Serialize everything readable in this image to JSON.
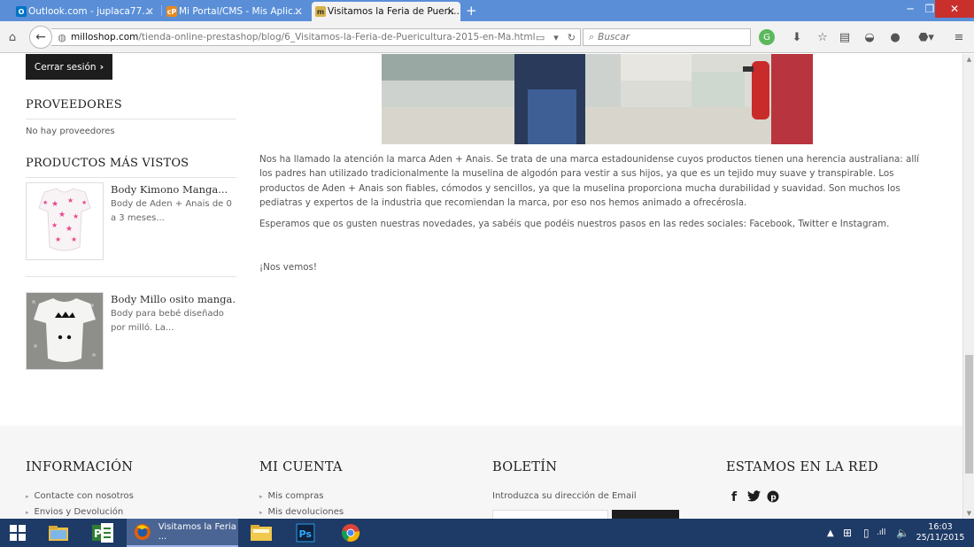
{
  "browser": {
    "tabs": [
      {
        "label": "Outlook.com - juplaca77...",
        "favicon": "outlook-icon",
        "color": "#0072c6",
        "active": false
      },
      {
        "label": "Mi Portal/CMS - Mis Aplic...",
        "favicon": "portal-icon",
        "color": "#e8891c",
        "active": false
      },
      {
        "label": "Visitamos la Feria de Pueri...",
        "favicon": "millo-icon",
        "color": "#d4b14a",
        "active": true
      }
    ],
    "url_host": "milloshop.com",
    "url_path": "/tienda-online-prestashop/blog/6_Visitamos-la-Feria-de-Puericultura-2015-en-Ma.html",
    "search_placeholder": "Buscar"
  },
  "sidebar": {
    "logout_label": "Cerrar sesión",
    "suppliers_title": "PROVEEDORES",
    "no_suppliers": "No hay proveedores",
    "viewed_title": "PRODUCTOS MÁS VISTOS",
    "products": [
      {
        "name": "Body Kimono Manga...",
        "description": "Body de Aden + Anais de 0 a 3 meses..."
      },
      {
        "name": "Body Millo osito manga...",
        "description": "Body para bebé diseñado por milló. La..."
      }
    ]
  },
  "article": {
    "paragraphs": [
      "Nos ha llamado la atención la marca Aden + Anais. Se trata de una marca estadounidense cuyos productos tienen una herencia australiana: allí los padres han utilizado tradicionalmente la muselina de algodón para vestir a sus hijos, ya que es un tejido muy suave y transpirable. Los productos de Aden + Anais son fiables, cómodos y sencillos, ya que la muselina proporciona mucha durabilidad y suavidad. Son muchos los pediatras y expertos de la industria que recomiendan la marca, por eso nos hemos animado a ofrecérosla.",
      "Esperamos que os gusten nuestras novedades, ya sabéis que podéis nuestros pasos en las redes sociales: Facebook, Twitter e Instagram.",
      "¡Nos vemos!"
    ]
  },
  "footer": {
    "info_title": "INFORMACIÓN",
    "info_links": [
      "Contacte con nosotros",
      "Envios y Devolución"
    ],
    "account_title": "MI CUENTA",
    "account_links": [
      "Mis compras",
      "Mis devoluciones"
    ],
    "newsletter_title": "BOLETÍN",
    "newsletter_text": "Introduzca su dirección de Email",
    "social_title": "ESTAMOS EN LA RED",
    "social_icons": [
      "facebook-icon",
      "twitter-icon",
      "pinterest-icon"
    ]
  },
  "taskbar": {
    "active_window": "Visitamos la Feria ...",
    "clock_time": "16:03",
    "clock_date": "25/11/2015"
  }
}
